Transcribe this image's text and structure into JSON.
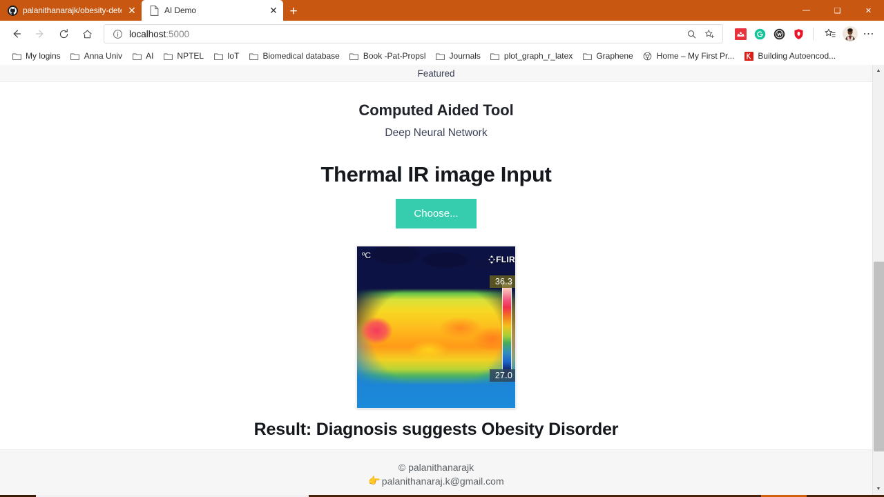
{
  "browser": {
    "tabs": [
      {
        "title": "palanithanarajk/obesity-detectio",
        "icon": "github-icon",
        "active": false,
        "close_label": "✕"
      },
      {
        "title": "AI Demo",
        "icon": "page-icon",
        "active": true,
        "close_label": "✕"
      }
    ],
    "new_tab_label": "+",
    "window_controls": {
      "minimize": "—",
      "maximize": "❑",
      "close": "✕"
    },
    "nav": {
      "back": "←",
      "forward": "→",
      "refresh": "↻",
      "home": "⌂"
    },
    "address": {
      "scheme_icon": "info-icon",
      "host": "localhost",
      "port": ":5000",
      "full": "localhost:5000"
    },
    "omnibox_buttons": [
      {
        "name": "search-in-page-icon",
        "glyph": "⌕"
      },
      {
        "name": "add-favorite-icon",
        "glyph": "☆"
      }
    ],
    "extensions": [
      {
        "name": "mendeley-extension-icon",
        "color": "#e8323c",
        "letter": "M"
      },
      {
        "name": "grammarly-extension-icon",
        "color": "#15c39a",
        "letter": "G"
      },
      {
        "name": "dark-circle-extension-icon",
        "color": "#2b2b2b",
        "letter": "W"
      },
      {
        "name": "opera-shield-extension-icon",
        "color": "#e8152a",
        "letter": "O"
      }
    ],
    "collections_icon": "collections-star-icon",
    "profile_icon": "profile-avatar",
    "settings_icon": "more-options-icon",
    "bookmarks": [
      {
        "label": "My logins",
        "icon": "folder-icon"
      },
      {
        "label": "Anna Univ",
        "icon": "folder-icon"
      },
      {
        "label": "AI",
        "icon": "folder-icon"
      },
      {
        "label": "NPTEL",
        "icon": "folder-icon"
      },
      {
        "label": "IoT",
        "icon": "folder-icon"
      },
      {
        "label": "Biomedical database",
        "icon": "folder-icon"
      },
      {
        "label": "Book -Pat-Propsl",
        "icon": "folder-icon"
      },
      {
        "label": "Journals",
        "icon": "folder-icon"
      },
      {
        "label": "plot_graph_r_latex",
        "icon": "folder-icon"
      },
      {
        "label": "Graphene",
        "icon": "folder-icon"
      },
      {
        "label": "Home – My First Pr...",
        "icon": "globe-icon"
      },
      {
        "label": "Building Autoencod...",
        "icon": "k-square-icon"
      }
    ]
  },
  "page": {
    "featured_bar": "Featured",
    "title": "Computed Aided Tool",
    "subtitle": "Deep Neural Network",
    "heading": "Thermal IR image Input",
    "choose_button": "Choose...",
    "thermal": {
      "unit_label": "ºC",
      "brand": "FLIR",
      "temp_max": "36.3",
      "temp_min": "27.0",
      "alt": "thermal infrared abdomen image"
    },
    "result": "Result: Diagnosis suggests Obesity Disorder",
    "footer": {
      "copyright": "© palanithanarajk",
      "email": "palanithanaraj.k@gmail.com",
      "email_icon": "👉"
    }
  },
  "colors": {
    "browser_accent": "#c85711",
    "button_teal": "#35cdad",
    "featured_bg": "#f7f7f7",
    "footer_bg": "#f6f6f6"
  }
}
